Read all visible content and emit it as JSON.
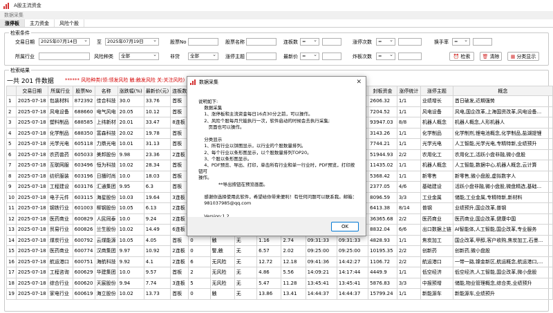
{
  "window": {
    "title": "A股主流资金"
  },
  "menubar": {
    "label": "数据采集"
  },
  "tabs": [
    {
      "label": "涨停板"
    },
    {
      "label": "主力资金"
    },
    {
      "label": "风险个股"
    }
  ],
  "search": {
    "legend": "检索条件",
    "trade_date_label": "交易日期",
    "date_from": "2025年07月14日",
    "to_label": "至",
    "date_to": "2025年07月19日",
    "stock_no_label": "股票No",
    "stock_name_label": "股票名称",
    "board_count_label": "连板数",
    "board_op": "=",
    "limit_times_label": "涨停次数",
    "limit_op": "=",
    "turnover_label": "换手率",
    "turnover_op": "=",
    "industry_label": "所属行业",
    "risk_type_label": "风险种类",
    "risk_type_value": "全部",
    "st_label": "非贷",
    "st_value": "全部",
    "theme_label": "涨停主题",
    "price_label": "最新价",
    "price_op": "=",
    "bomb_label": "炸板次数",
    "bomb_op": "=",
    "search_btn": "检索",
    "clear_btn": "清除",
    "category_btn": "分类显示"
  },
  "results": {
    "legend": "检索结果",
    "count_text": "一共 201 件数据",
    "warning": "******  风险种类(领:领发风险 触:触发风险 关:关注风险)"
  },
  "table": {
    "headers": [
      "",
      "交易日期",
      "所属行业",
      "股票No",
      "名称",
      "涨跌幅(%)",
      "最新价(元)",
      "连板数",
      "",
      "",
      "",
      "",
      "",
      "",
      "",
      "封板资金",
      "涨停统计",
      "涨停主题",
      "概念"
    ],
    "rows": [
      [
        "1",
        "2025-07-18",
        "包装材料",
        "872392",
        "佳合科技",
        "30.0",
        "33.76",
        "首板",
        "",
        "",
        "",
        "",
        "",
        "",
        "",
        "2606.32",
        "1/1",
        "业绩增长",
        "首日破发,近期强势"
      ],
      [
        "2",
        "2025-07-18",
        "风电设备",
        "688660",
        "电气风电",
        "20.05",
        "10.12",
        "首板",
        "",
        "",
        "",
        "",
        "",
        "",
        "",
        "7204.52",
        "1/1",
        "风电设备",
        "风电,国企改革,上海国资改革,风电设备..."
      ],
      [
        "3",
        "2025-07-18",
        "塑料制品",
        "688585",
        "上纬新材",
        "20.01",
        "33.47",
        "8连板",
        "",
        "",
        "",
        "",
        "",
        "",
        "",
        "93947.03",
        "8/8",
        "机器人概念",
        "机器人概念,人形机器人"
      ],
      [
        "4",
        "2025-07-18",
        "化学制品",
        "688350",
        "富森科技",
        "20.02",
        "19.78",
        "首板",
        "",
        "",
        "",
        "",
        "",
        "",
        "",
        "3143.26",
        "1/1",
        "化学制品",
        "化学制剂,锂电池概念,化学制品,盐湖提锂"
      ],
      [
        "5",
        "2025-07-18",
        "光学光电",
        "605118",
        "力鼎光电",
        "10.01",
        "31.13",
        "首板",
        "",
        "",
        "",
        "",
        "",
        "",
        "",
        "7744.21",
        "1/1",
        "光学光电",
        "人工智能,光学光电,专精特新,业绩预升"
      ],
      [
        "6",
        "2025-07-18",
        "农药兽药",
        "605033",
        "美邦股份",
        "9.98",
        "23.36",
        "2连板",
        "",
        "",
        "",
        "",
        "",
        "",
        "",
        "51944.93",
        "2/2",
        "农用化工",
        "农用化工,活跃小盘非融,微小盘股"
      ],
      [
        "7",
        "2025-07-18",
        "互联网服",
        "603496",
        "恒为科技",
        "10.02",
        "28.34",
        "首板",
        "",
        "",
        "",
        "",
        "",
        "",
        "",
        "11435.02",
        "1/1",
        "机器人概念",
        "人工智能,数据中心,机器人概念,云计算"
      ],
      [
        "8",
        "2025-07-18",
        "纺织服装",
        "603196",
        "日播时尚",
        "10.0",
        "18.03",
        "首板",
        "",
        "",
        "",
        "",
        "",
        "",
        "",
        "5368.42",
        "1/1",
        "新零售",
        "新零售,微小盘股,虚拟数字人"
      ],
      [
        "9",
        "2025-07-18",
        "工程建设",
        "603176",
        "汇通集团",
        "9.95",
        "6.3",
        "首板",
        "",
        "",
        "",
        "",
        "",
        "",
        "",
        "2377.05",
        "4/6",
        "基础建设",
        "活跃小盘非融,微小盘股,微盘精选,基础..."
      ],
      [
        "10",
        "2025-07-18",
        "电子元件",
        "603115",
        "海星股份",
        "10.03",
        "19.64",
        "3连板",
        "",
        "",
        "",
        "",
        "",
        "",
        "",
        "8096.59",
        "3/3",
        "工业金属",
        "储能,工业金属,专精特新,新材料"
      ],
      [
        "11",
        "2025-07-18",
        "钢铁行业",
        "601003",
        "柳钢股份",
        "10.05",
        "6.13",
        "2连板",
        "",
        "",
        "",
        "",
        "",
        "",
        "",
        "6413.38",
        "8/14",
        "普钢",
        "业绩预升,国企改革,普钢"
      ],
      [
        "12",
        "2025-07-18",
        "医药商业",
        "600829",
        "人民同泰",
        "10.0",
        "9.24",
        "2连板",
        "",
        "",
        "",
        "",
        "",
        "",
        "",
        "36365.68",
        "2/2",
        "医药商业",
        "医药商业,国企改革,健康中国"
      ],
      [
        "13",
        "2025-07-18",
        "贸易行业",
        "600826",
        "兰生股份",
        "10.02",
        "14.49",
        "6连板",
        "",
        "",
        "",
        "",
        "",
        "",
        "",
        "8832.04",
        "6/6",
        "出口数据上链",
        "AI智能体,人工智能,国企改革,专业服务"
      ],
      [
        "14",
        "2025-07-18",
        "煤炭行业",
        "600792",
        "云煤能源",
        "10.05",
        "4.05",
        "首板",
        "0",
        "触",
        "无",
        "1.16",
        "2.74",
        "09:31:33",
        "09:31:33",
        "4828.93",
        "1/1",
        "焦炭加工",
        "国企改革,甲醇,客户收购,焦炭加工,石墨..."
      ],
      [
        "15",
        "2025-07-18",
        "医药商业",
        "600774",
        "汉商集团",
        "9.97",
        "10.92",
        "2连板",
        "0",
        "警,触",
        "无",
        "6.57",
        "2.02",
        "09:25:00",
        "09:25:00",
        "10195.35",
        "2/2",
        "创新药",
        "创新药,微小盘股"
      ],
      [
        "16",
        "2025-07-18",
        "航运港口",
        "600751",
        "海航科技",
        "9.92",
        "4.1",
        "2连板",
        "6",
        "无风险",
        "无",
        "12.72",
        "12.18",
        "09:41:36",
        "14:42:27",
        "1106.72",
        "2/2",
        "航运港口",
        "一带一路,镍金新区,航运概念,航运港口,..."
      ],
      [
        "17",
        "2025-07-18",
        "工程咨询",
        "600629",
        "华建集团",
        "10.0",
        "9.57",
        "首板",
        "2",
        "无风险",
        "无",
        "4.86",
        "5.56",
        "14:09:21",
        "14:17:44",
        "4449.9",
        "1/1",
        "低空经济",
        "低空经济,人工智能,国企改革,微小盘股"
      ],
      [
        "18",
        "2025-07-18",
        "综合行业",
        "600620",
        "天宸股份",
        "9.94",
        "7.74",
        "3连板",
        "5",
        "无风险",
        "无",
        "5.47",
        "11.28",
        "13:45:41",
        "13:45:41",
        "5876.83",
        "3/3",
        "中报预增",
        "储能,物业管理概念,综合类,业绩预升"
      ],
      [
        "19",
        "2025-07-18",
        "家电行业",
        "600619",
        "海立股份",
        "10.02",
        "13.73",
        "首板",
        "0",
        "触",
        "无",
        "13.86",
        "13.41",
        "14:44:37",
        "14:44:37",
        "15799.24",
        "1/1",
        "新能源车",
        "新能源车,业绩预升"
      ]
    ]
  },
  "dialog": {
    "title": "数据采集",
    "close": "✕",
    "body": "说明如下:\n    数据采集\n    1、涨停板和主流资金每日16点30分之前，可以操作。\n    2、风险个股每月只能执行一次，软件启动的时候会去执行采集;\n       页面也可以操作。\n\n    分类显示\n    1、所有行业以饼图显示，以行业的个股数量排列。\n    2、每个行业以条形图显示，以个股数量排列TOP20。\n    3、个股以条形图显示。\n    4、PDF预览、导出、打印，单击所有行业和单一行业时，PDF预览，打印按钮可\n操作。\n              **导出按钮在预览画面。\n\n    感谢你选择使用此软件，希望给你带来便利！有任何问题可以联系我。邮箱：\n    981037985@qq.com\n\n    Version:1.2",
    "ok": "OK"
  },
  "colors": {
    "warning": "#d40000",
    "accent": "#d32f2f",
    "ok_border": "#0078d4"
  }
}
